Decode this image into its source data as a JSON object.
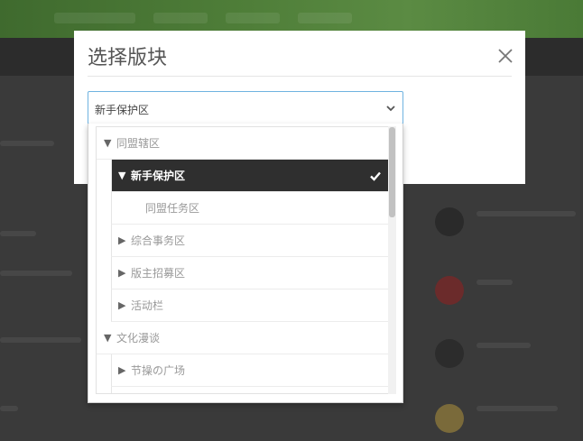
{
  "modal": {
    "title": "选择版块"
  },
  "select": {
    "value": "新手保护区"
  },
  "tree": [
    {
      "label": "同盟辖区",
      "expander": "▼",
      "selected": false
    },
    {
      "label": "新手保护区",
      "expander": "▼",
      "selected": true
    },
    {
      "label": "同盟任务区",
      "expander": "",
      "selected": false
    },
    {
      "label": "综合事务区",
      "expander": "▶",
      "selected": false
    },
    {
      "label": "版主招募区",
      "expander": "▶",
      "selected": false
    },
    {
      "label": "活动栏",
      "expander": "▶",
      "selected": false
    },
    {
      "label": "文化漫谈",
      "expander": "▼",
      "selected": false
    },
    {
      "label": "节操の广场",
      "expander": "▶",
      "selected": false
    }
  ],
  "icons": {
    "close": "close-icon",
    "chevron": "chevron-down-icon",
    "check": "check-icon",
    "expand": "triangle-right-icon",
    "collapse": "triangle-down-icon"
  },
  "colors": {
    "topbar": "#4e7d38",
    "selected_bg": "#2f2f2f",
    "select_border": "#6fb3e0",
    "overlay": "#3a3a3a"
  }
}
